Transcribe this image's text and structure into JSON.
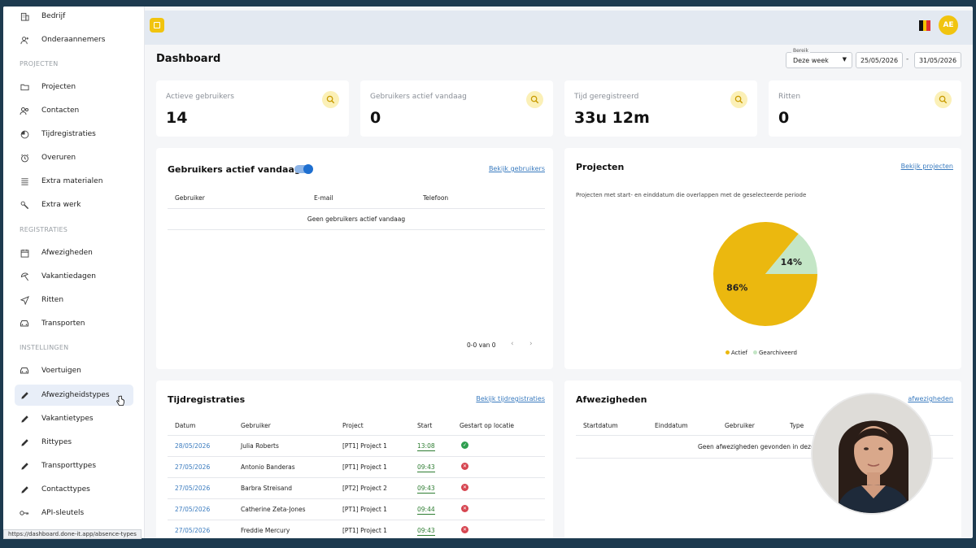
{
  "sidebar": {
    "top_items": [
      {
        "label": "Bedrijf",
        "icon": "building-icon"
      },
      {
        "label": "Onderaannemers",
        "icon": "user-plus-icon"
      }
    ],
    "sections": [
      {
        "label": "PROJECTEN",
        "items": [
          {
            "label": "Projecten",
            "icon": "folder-icon"
          },
          {
            "label": "Contacten",
            "icon": "contacts-icon"
          },
          {
            "label": "Tijdregistraties",
            "icon": "timer-icon"
          },
          {
            "label": "Overuren",
            "icon": "alarm-clock-icon"
          },
          {
            "label": "Extra materialen",
            "icon": "list-icon"
          },
          {
            "label": "Extra werk",
            "icon": "wrench-icon"
          }
        ]
      },
      {
        "label": "REGISTRATIES",
        "items": [
          {
            "label": "Afwezigheden",
            "icon": "calendar-icon"
          },
          {
            "label": "Vakantiedagen",
            "icon": "umbrella-icon"
          },
          {
            "label": "Ritten",
            "icon": "navigation-icon"
          },
          {
            "label": "Transporten",
            "icon": "car-icon"
          }
        ]
      },
      {
        "label": "INSTELLINGEN",
        "items": [
          {
            "label": "Voertuigen",
            "icon": "car-icon"
          },
          {
            "label": "Afwezigheidstypes",
            "icon": "pencil-icon",
            "active": true
          },
          {
            "label": "Vakantietypes",
            "icon": "pencil-icon"
          },
          {
            "label": "Rittypes",
            "icon": "pencil-icon"
          },
          {
            "label": "Transporttypes",
            "icon": "pencil-icon"
          },
          {
            "label": "Contacttypes",
            "icon": "pencil-icon"
          },
          {
            "label": "API-sleutels",
            "icon": "key-icon"
          }
        ]
      }
    ]
  },
  "topbar": {
    "avatar_initials": "AE",
    "flag_colors": [
      "#111111",
      "#f2c200",
      "#e03030"
    ]
  },
  "page": {
    "title": "Dashboard"
  },
  "range": {
    "label": "Bereik",
    "selected": "Deze week",
    "start_date": "25/05/2026",
    "end_date": "31/05/2026",
    "separator": "-"
  },
  "stats": [
    {
      "label": "Actieve gebruikers",
      "value": "14"
    },
    {
      "label": "Gebruikers actief vandaag",
      "value": "0"
    },
    {
      "label": "Tijd geregistreerd",
      "value": "33u 12m"
    },
    {
      "label": "Ritten",
      "value": "0"
    }
  ],
  "active_users": {
    "title": "Gebruikers actief vandaag",
    "link": "Bekijk gebruikers",
    "columns": [
      "Gebruiker",
      "E-mail",
      "Telefoon"
    ],
    "empty_text": "Geen gebruikers actief vandaag",
    "pagination": "0-0 van 0"
  },
  "projects": {
    "title": "Projecten",
    "link": "Bekijk projecten",
    "subtitle": "Projecten met start- en einddatum die overlappen met de geselecteerde periode",
    "slice_labels": [
      "86%",
      "14%"
    ],
    "legend": [
      "Actief",
      "Gearchiveerd"
    ]
  },
  "chart_data": {
    "type": "pie",
    "categories": [
      "Actief",
      "Gearchiveerd"
    ],
    "values": [
      86,
      14
    ],
    "colors": [
      "#ebb80f",
      "#c4e6c6"
    ],
    "title": "Projecten",
    "legend_position": "bottom"
  },
  "time_registrations": {
    "title": "Tijdregistraties",
    "link": "Bekijk tijdregistraties",
    "columns": [
      "Datum",
      "Gebruiker",
      "Project",
      "Start",
      "Gestart op locatie"
    ],
    "rows": [
      {
        "date": "28/05/2026",
        "user": "Julia Roberts",
        "project": "[PT1] Project 1",
        "start": "13:08",
        "on_location": true
      },
      {
        "date": "27/05/2026",
        "user": "Antonio Banderas",
        "project": "[PT1] Project 1",
        "start": "09:43",
        "on_location": false
      },
      {
        "date": "27/05/2026",
        "user": "Barbra Streisand",
        "project": "[PT2] Project 2",
        "start": "09:43",
        "on_location": false
      },
      {
        "date": "27/05/2026",
        "user": "Catherine Zeta-Jones",
        "project": "[PT1] Project 1",
        "start": "09:44",
        "on_location": false
      },
      {
        "date": "27/05/2026",
        "user": "Freddie Mercury",
        "project": "[PT1] Project 1",
        "start": "09:43",
        "on_location": false
      }
    ]
  },
  "absences": {
    "title": "Afwezigheden",
    "link": "afwezigheden",
    "columns": [
      "Startdatum",
      "Einddatum",
      "Gebruiker",
      "Type"
    ],
    "empty_text": "Geen afwezigheden gevonden in deze p"
  },
  "statusbar": {
    "url": "https://dashboard.done-it.app/absence-types"
  }
}
